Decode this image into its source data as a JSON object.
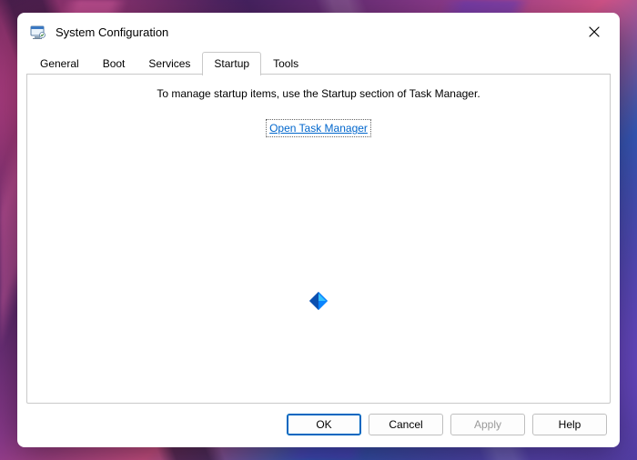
{
  "window": {
    "title": "System Configuration"
  },
  "tabs": {
    "items": [
      {
        "label": "General"
      },
      {
        "label": "Boot"
      },
      {
        "label": "Services"
      },
      {
        "label": "Startup"
      },
      {
        "label": "Tools"
      }
    ],
    "active_index": 3
  },
  "startup_panel": {
    "message": "To manage startup items, use the Startup section of Task Manager.",
    "link_label": "Open Task Manager"
  },
  "buttons": {
    "ok": "OK",
    "cancel": "Cancel",
    "apply": "Apply",
    "help": "Help"
  }
}
